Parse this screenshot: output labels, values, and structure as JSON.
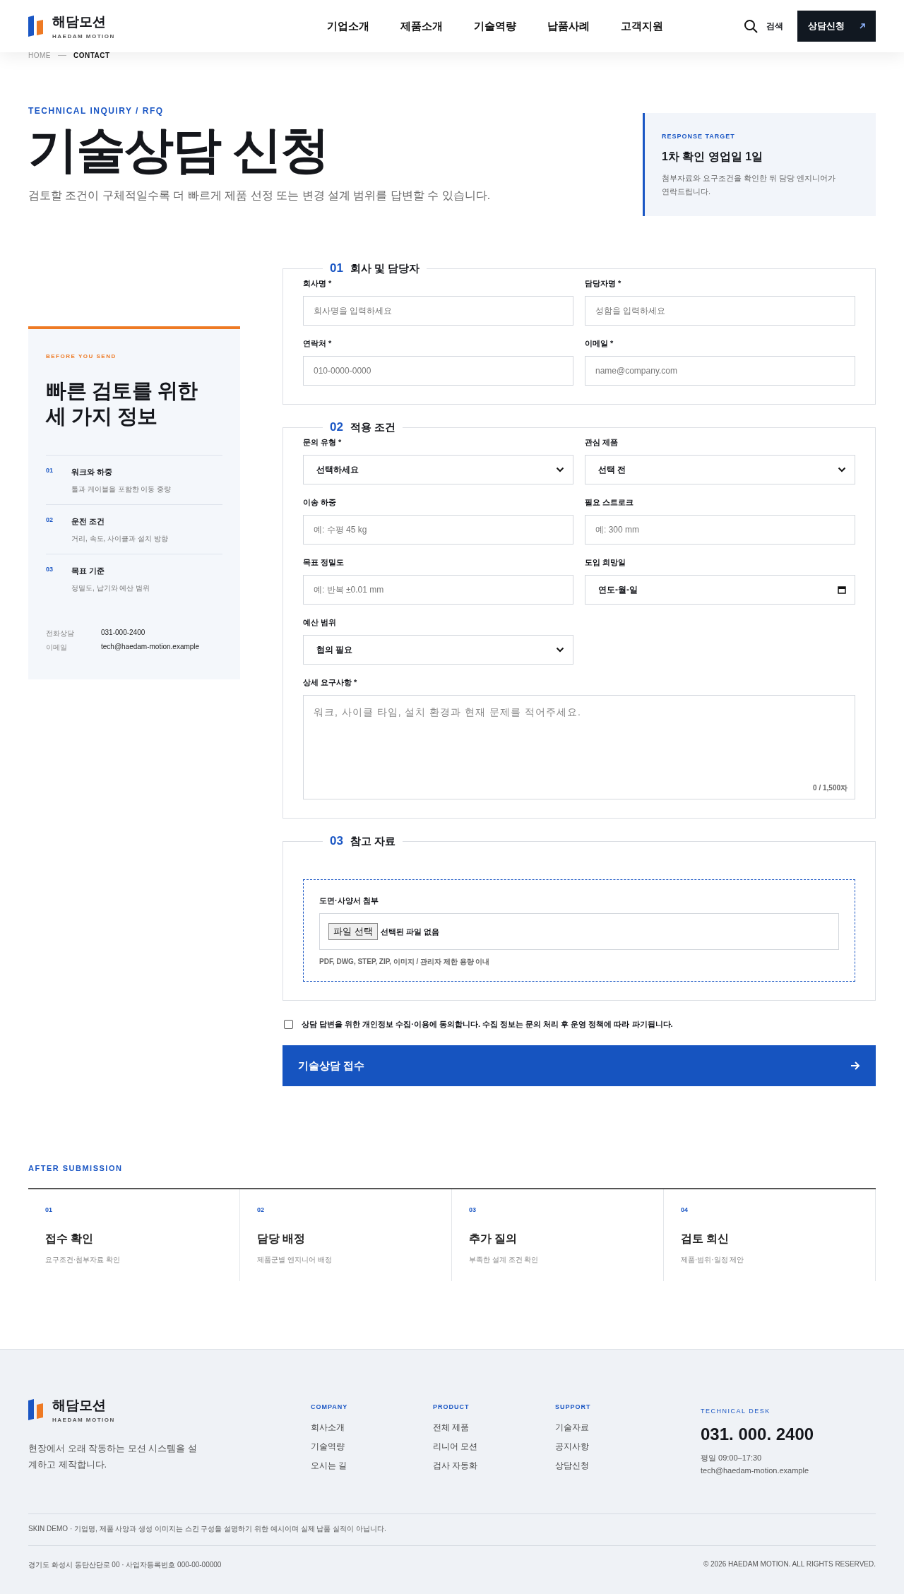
{
  "header": {
    "logo": {
      "name": "해담모션",
      "sub": "HAEDAM MOTION"
    },
    "nav": [
      {
        "label": "기업소개",
        "selected": false
      },
      {
        "label": "제품소개",
        "selected": false
      },
      {
        "label": "기술역량",
        "selected": false
      },
      {
        "label": "납품사례",
        "selected": false
      },
      {
        "label": "고객지원",
        "selected": false
      }
    ],
    "search_label": "검색",
    "cta": "상담신청"
  },
  "breadcrumb": [
    "HOME",
    "CONTACT"
  ],
  "hero": {
    "eyebrow": "TECHNICAL INQUIRY / RFQ",
    "title": "기술상담 신청",
    "subtitle": "검토할 조건이 구체적일수록 더 빠르게 제품 선정 또는 변경 설계 범위를 답변할 수 있습니다.",
    "target": {
      "eyebrow": "RESPONSE TARGET",
      "title": "1차 확인 영업일 1일",
      "text": "첨부자료와 요구조건을 확인한 뒤 담당 엔지니어가 연락드립니다."
    }
  },
  "guide": {
    "eyebrow": "BEFORE YOU SEND",
    "title": "빠른 검토를 위한 세 가지 정보",
    "items": [
      {
        "num": "01",
        "title": "워크와 하중",
        "desc": "툴과 케이블을 포함한 이동 중량"
      },
      {
        "num": "02",
        "title": "운전 조건",
        "desc": "거리, 속도, 사이클과 설치 방향"
      },
      {
        "num": "03",
        "title": "목표 기준",
        "desc": "정밀도, 납기와 예산 범위"
      }
    ],
    "contacts": [
      {
        "label": "전화상담",
        "value": "031-000-2400"
      },
      {
        "label": "이메일",
        "value": "tech@haedam-motion.example"
      }
    ]
  },
  "sections": [
    {
      "num": "01",
      "title": "회사 및 담당자",
      "fields": [
        {
          "kind": "input",
          "label": "회사명 *",
          "placeholder": "회사명을 입력하세요"
        },
        {
          "kind": "input",
          "label": "담당자명 *",
          "placeholder": "성함을 입력하세요"
        },
        {
          "kind": "input",
          "label": "연락처 *",
          "placeholder": "010-0000-0000"
        },
        {
          "kind": "input",
          "label": "이메일 *",
          "placeholder": "name@company.com"
        }
      ]
    },
    {
      "num": "02",
      "title": "적용 조건",
      "fields": [
        {
          "kind": "select",
          "label": "문의 유형 *",
          "value": "선택하세요"
        },
        {
          "kind": "select",
          "label": "관심 제품",
          "value": "선택 전"
        },
        {
          "kind": "input",
          "label": "이송 하중",
          "placeholder": "예: 수평 45 kg"
        },
        {
          "kind": "input",
          "label": "필요 스트로크",
          "placeholder": "예: 300 mm"
        },
        {
          "kind": "input",
          "label": "목표 정밀도",
          "placeholder": "예: 반복 ±0.01 mm"
        },
        {
          "kind": "date",
          "label": "도입 희망일",
          "value": "연도-월-일"
        },
        {
          "kind": "select",
          "label": "예산 범위",
          "value": "협의 필요"
        },
        {
          "kind": "textarea",
          "label": "상세 요구사항 *",
          "placeholder": "워크, 사이클 타임, 설치 환경과 현재 문제를 적어주세요.",
          "counter": "0 / 1,500자"
        }
      ]
    },
    {
      "num": "03",
      "title": "참고 자료",
      "fields": [
        {
          "kind": "file",
          "label": "도면·사양서 첨부",
          "button": "파일 선택",
          "status": "선택된 파일 없음",
          "hint": "PDF, DWG, STEP, ZIP, 이미지 / 관리자 제한 용량 이내"
        }
      ]
    }
  ],
  "consent": {
    "text": "상담 답변을 위한 개인정보 수집·이용에 동의합니다. 수집 정보는 문의 처리 후 운영 정책에 따라 파기됩니다.",
    "checked": false
  },
  "submit": "기술상담 접수",
  "after": {
    "eyebrow": "AFTER SUBMISSION",
    "steps": [
      {
        "num": "01",
        "title": "접수 확인",
        "desc": "요구조건·첨부자료 확인"
      },
      {
        "num": "02",
        "title": "담당 배정",
        "desc": "제품군별 엔지니어 배정"
      },
      {
        "num": "03",
        "title": "추가 질의",
        "desc": "부족한 설계 조건 확인"
      },
      {
        "num": "04",
        "title": "검토 회신",
        "desc": "제품·범위·일정 제안"
      }
    ]
  },
  "footer": {
    "logo": {
      "name": "해담모션",
      "sub": "HAEDAM MOTION"
    },
    "tagline": "현장에서 오래 작동하는 모션 시스템을 설계하고 제작합니다.",
    "columns": [
      {
        "heading": "COMPANY",
        "links": [
          "회사소개",
          "기술역량",
          "오시는 길"
        ]
      },
      {
        "heading": "PRODUCT",
        "links": [
          "전체 제품",
          "리니어 모션",
          "검사 자동화"
        ]
      },
      {
        "heading": "SUPPORT",
        "links": [
          "기술자료",
          "공지사항",
          "상담신청"
        ]
      }
    ],
    "desk": {
      "eyebrow": "TECHNICAL DESK",
      "phone": "031. 000. 2400",
      "hours": "평일 09:00–17:30",
      "email": "tech@haedam-motion.example"
    },
    "notice": "SKIN DEMO · 기업명, 제품 사양과 생성 이미지는 스킨 구성을 설명하기 위한 예시이며 실제 납품 실적이 아닙니다.",
    "address": "경기도 화성시 동탄산단로 00 · 사업자등록번호 000-00-00000",
    "copyright": "© 2026 HAEDAM MOTION. ALL RIGHTS RESERVED."
  }
}
